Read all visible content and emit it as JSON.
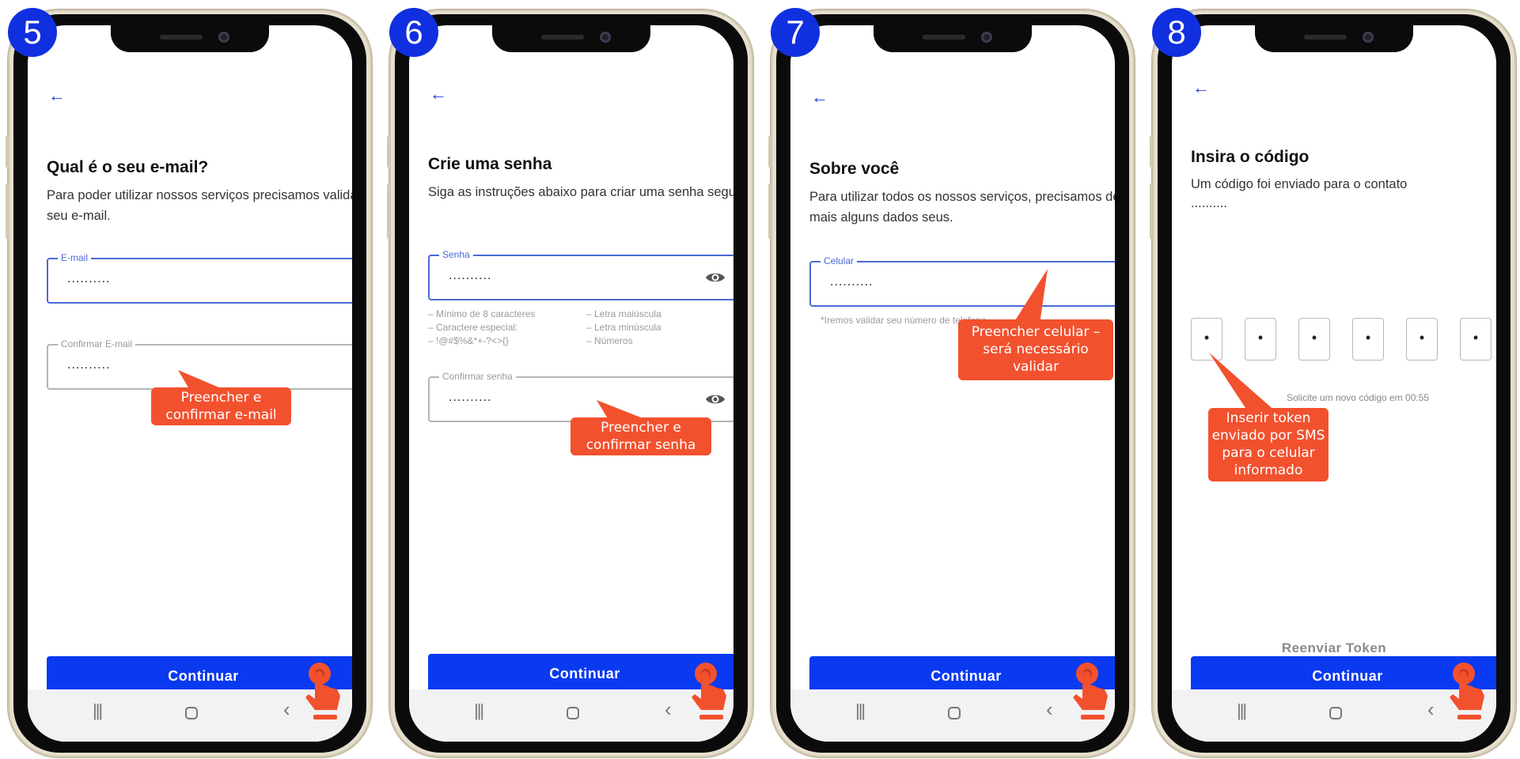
{
  "panels": [
    {
      "step": "5",
      "title": "Qual é o seu e-mail?",
      "description": "Para poder utilizar nossos serviços precisamos validar seu e-mail.",
      "fields": [
        {
          "label": "E-mail",
          "value": "..........",
          "active": true
        },
        {
          "label": "Confirmar E-mail",
          "value": "..........",
          "active": false
        }
      ],
      "callout": "Preencher e confirmar e-mail",
      "button": "Continuar"
    },
    {
      "step": "6",
      "title": "Crie uma senha",
      "description": "Siga as instruções abaixo para criar uma senha segura.",
      "fields": [
        {
          "label": "Senha",
          "value": "..........",
          "active": true,
          "icon": "eye-icon"
        },
        {
          "label": "Confirmar senha",
          "value": "..........",
          "active": false,
          "icon": "eye-icon"
        }
      ],
      "rules": [
        "– Mínimo de 8 caracteres",
        "– Letra maiúscula",
        "– Caractere especial:",
        "– Letra minúscula",
        "– !@#$%&*+-?<>{}",
        "– Números"
      ],
      "callout": "Preencher e confirmar senha",
      "button": "Continuar"
    },
    {
      "step": "7",
      "title": "Sobre você",
      "description": "Para utilizar todos os nossos serviços, precisamos de mais alguns dados seus.",
      "fields": [
        {
          "label": "Celular",
          "value": "..........",
          "active": true
        }
      ],
      "hint": "*Iremos validar seu número de telefone",
      "callout": "Preencher celular – será necessário validar",
      "button": "Continuar"
    },
    {
      "step": "8",
      "title": "Insira o código",
      "description": "Um código foi enviado para o contato",
      "contact": "..........",
      "otp": [
        "•",
        "•",
        "•",
        "•",
        "•",
        "•"
      ],
      "timer": "Solicite um novo código em 00:55",
      "resend": "Reenviar Token",
      "callout": "Inserir token enviado por SMS para o celular informado",
      "button": "Continuar"
    }
  ],
  "icons": {
    "back": "arrow-left-icon",
    "eye": "eye-icon",
    "hand": "tap-hand-icon",
    "nav": [
      "menu-icon",
      "home-icon",
      "back-chevron-icon"
    ]
  },
  "colors": {
    "primary": "#0a3af0",
    "step_badge": "#1030e0",
    "callout": "#f2512e",
    "active_border": "#4a6ad8"
  }
}
